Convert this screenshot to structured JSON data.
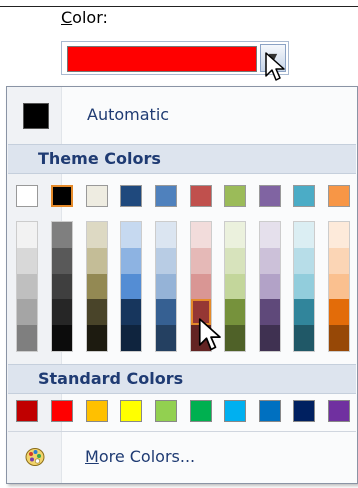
{
  "field": {
    "label_hotkey": "C",
    "label_rest": "olor:",
    "selected_color": "#ff0000"
  },
  "automatic": {
    "label": "Automatic",
    "color": "#000000"
  },
  "theme": {
    "header": "Theme Colors",
    "base": [
      "#ffffff",
      "#000000",
      "#eeece1",
      "#1f497d",
      "#4f81bd",
      "#c0504d",
      "#9bbb59",
      "#8064a2",
      "#4bacc6",
      "#f79646"
    ],
    "shades": [
      [
        "#f2f2f2",
        "#d8d8d8",
        "#bfbfbf",
        "#a5a5a5",
        "#7f7f7f"
      ],
      [
        "#7f7f7f",
        "#595959",
        "#3f3f3f",
        "#262626",
        "#0c0c0c"
      ],
      [
        "#ddd9c3",
        "#c4bd97",
        "#938953",
        "#494429",
        "#1d1b10"
      ],
      [
        "#c6d9f0",
        "#8db3e2",
        "#548dd4",
        "#17365d",
        "#0f243e"
      ],
      [
        "#dbe5f1",
        "#b8cce4",
        "#95b3d7",
        "#366092",
        "#244061"
      ],
      [
        "#f2dcdb",
        "#e5b9b7",
        "#d99694",
        "#953734",
        "#632423"
      ],
      [
        "#ebf1dd",
        "#d7e3bc",
        "#c3d69b",
        "#76923c",
        "#4f6128"
      ],
      [
        "#e5e0ec",
        "#ccc1d9",
        "#b2a2c7",
        "#5f497a",
        "#3f3151"
      ],
      [
        "#dbeef3",
        "#b7dde8",
        "#92cddc",
        "#31859b",
        "#205867"
      ],
      [
        "#fdeada",
        "#fbd5b5",
        "#fac08f",
        "#e36c09",
        "#974806"
      ]
    ],
    "selected_col": 5,
    "selected_row": 3
  },
  "standard": {
    "header": "Standard Colors",
    "colors": [
      "#c00000",
      "#ff0000",
      "#ffc000",
      "#ffff00",
      "#92d050",
      "#00b050",
      "#00b0f0",
      "#0070c0",
      "#002060",
      "#7030a0"
    ]
  },
  "more": {
    "hotkey": "M",
    "label_rest": "ore Colors..."
  }
}
